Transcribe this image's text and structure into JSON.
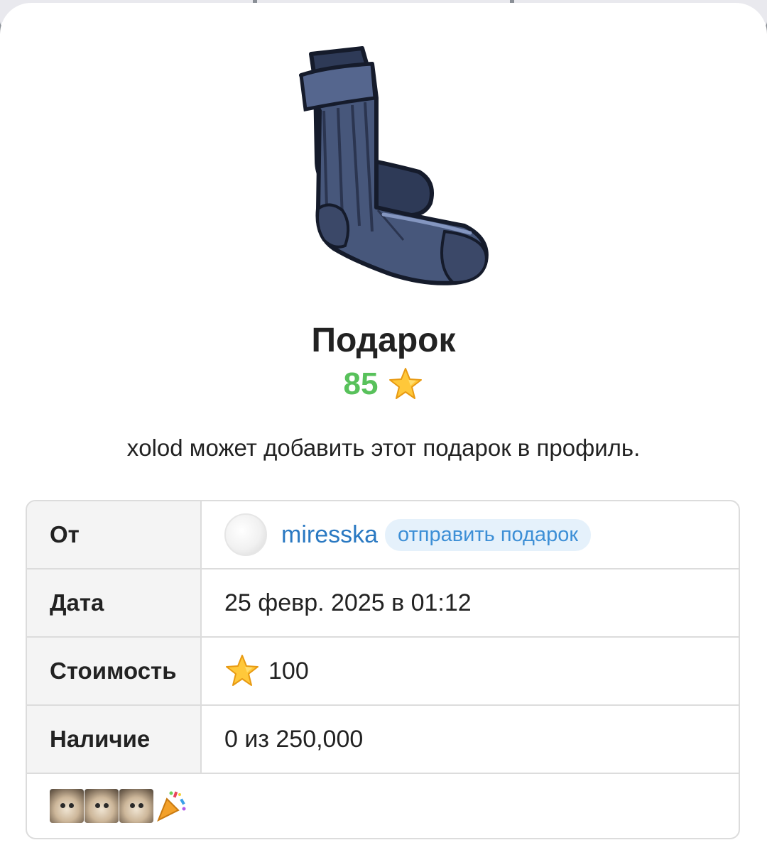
{
  "gift": {
    "title": "Подарок",
    "price": "85",
    "description": "xolod может добавить этот подарок в профиль.",
    "image_icon": "socks-icon",
    "price_icon": "star-icon"
  },
  "details": {
    "from": {
      "label": "От",
      "username": "miresska",
      "send_gift_label": "отправить подарок",
      "avatar_icon": "avatar"
    },
    "date": {
      "label": "Дата",
      "value": "25 февр. 2025 в 01:12"
    },
    "cost": {
      "label": "Стоимость",
      "value": "100",
      "icon": "star-icon"
    },
    "availability": {
      "label": "Наличие",
      "value": "0 из 250,000"
    },
    "message_emojis": [
      "cat-emoji-icon",
      "cat-emoji-icon",
      "cat-emoji-icon",
      "party-popper-icon"
    ]
  },
  "colors": {
    "price_green": "#58c15b",
    "link_blue": "#2a79c2",
    "pill_bg": "#e5f1fb",
    "pill_text": "#3d8fd6"
  }
}
